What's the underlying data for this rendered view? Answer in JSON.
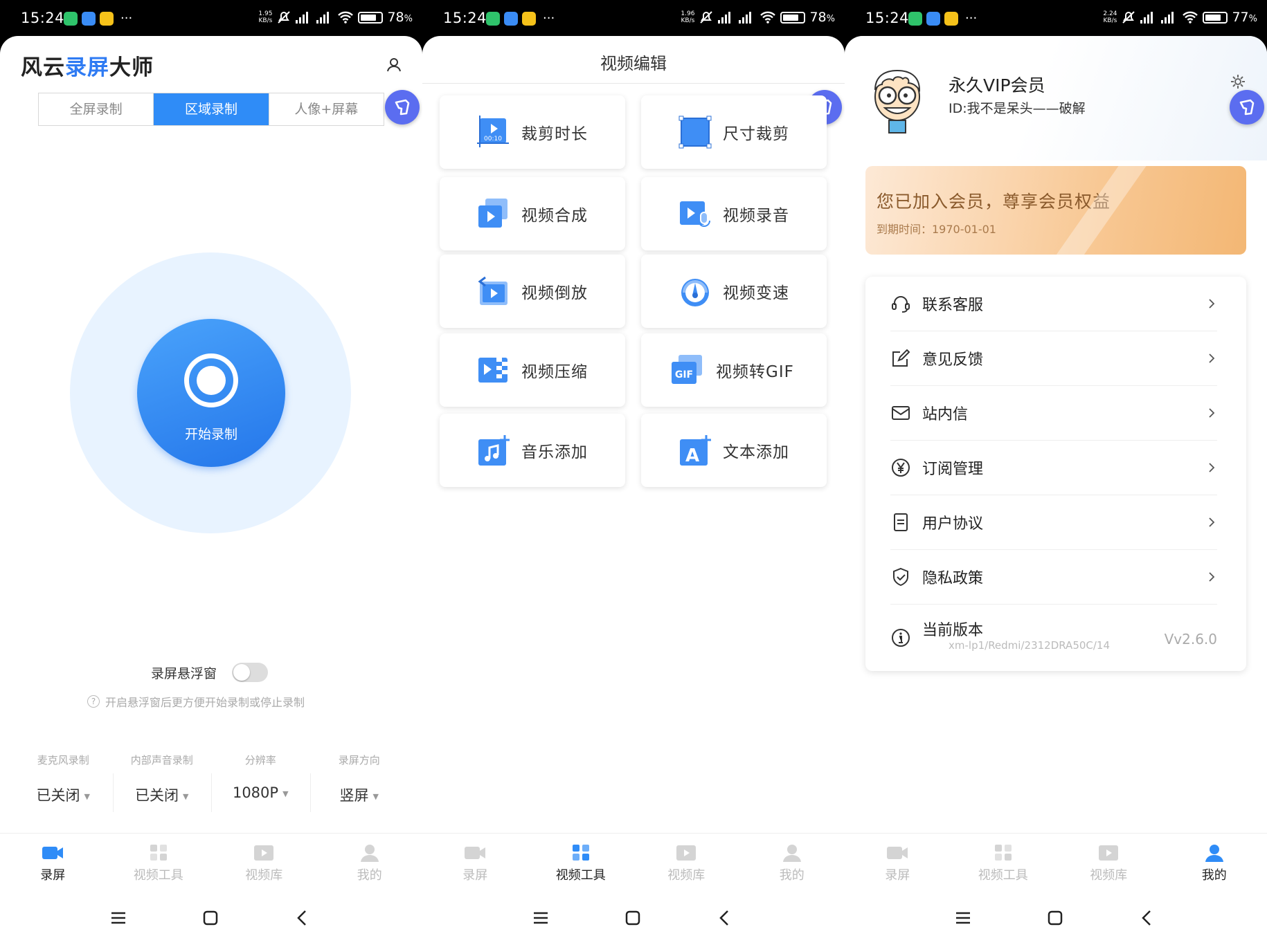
{
  "status": [
    {
      "time": "15:24",
      "speed_top": "1.95",
      "speed_unit": "KB/s",
      "battery": "78",
      "battery_unit": "%",
      "battery_fill": 0.78
    },
    {
      "time": "15:24",
      "speed_top": "1.96",
      "speed_unit": "KB/s",
      "battery": "78",
      "battery_unit": "%",
      "battery_fill": 0.78
    },
    {
      "time": "15:24",
      "speed_top": "2.24",
      "speed_unit": "KB/s",
      "battery": "77",
      "battery_unit": "%",
      "battery_fill": 0.77
    }
  ],
  "colors": {
    "accent": "#2f8cf7",
    "float_button": "#5b6df0",
    "vip_text": "#8a5a2c"
  },
  "record": {
    "brand_prefix": "风云",
    "brand_highlight": "录屏",
    "brand_suffix": "大师",
    "modes": [
      "全屏录制",
      "区域录制",
      "人像+屏幕"
    ],
    "active_mode": 1,
    "start_label": "开始录制",
    "float_label": "录屏悬浮窗",
    "float_enabled": false,
    "float_hint": "开启悬浮窗后更方便开始录制或停止录制",
    "settings": [
      {
        "label": "麦克风录制",
        "value": "已关闭"
      },
      {
        "label": "内部声音录制",
        "value": "已关闭"
      },
      {
        "label": "分辨率",
        "value": "1080P"
      },
      {
        "label": "录屏方向",
        "value": "竖屏"
      }
    ]
  },
  "tools": {
    "title": "视频编辑",
    "items": [
      {
        "label": "裁剪时长",
        "icon": "trim-duration-icon",
        "badge": "00:10"
      },
      {
        "label": "尺寸裁剪",
        "icon": "crop-size-icon"
      },
      {
        "label": "视频合成",
        "icon": "video-merge-icon"
      },
      {
        "label": "视频录音",
        "icon": "video-voice-icon"
      },
      {
        "label": "视频倒放",
        "icon": "video-reverse-icon"
      },
      {
        "label": "视频变速",
        "icon": "video-speed-icon"
      },
      {
        "label": "视频压缩",
        "icon": "video-compress-icon"
      },
      {
        "label": "视频转GIF",
        "icon": "video-gif-icon",
        "badge": "GIF"
      },
      {
        "label": "音乐添加",
        "icon": "music-add-icon"
      },
      {
        "label": "文本添加",
        "icon": "text-add-icon",
        "badge": "A"
      }
    ]
  },
  "profile": {
    "name": "永久VIP会员",
    "id": "ID:我不是呆头——破解",
    "vip_title": "您已加入会员，尊享会员权益",
    "vip_expire": "到期时间：1970-01-01",
    "menu": [
      {
        "label": "联系客服",
        "icon": "headset-icon"
      },
      {
        "label": "意见反馈",
        "icon": "feedback-edit-icon"
      },
      {
        "label": "站内信",
        "icon": "mail-icon"
      },
      {
        "label": "订阅管理",
        "icon": "yuan-coin-icon"
      },
      {
        "label": "用户协议",
        "icon": "document-icon"
      },
      {
        "label": "隐私政策",
        "icon": "shield-check-icon"
      }
    ],
    "version_label": "当前版本",
    "version_sub": "xm-lp1/Redmi/2312DRA50C/14",
    "version_value": "Vv2.6.0"
  },
  "tabbar": {
    "tabs": [
      {
        "label": "录屏",
        "icon": "record-tab-icon"
      },
      {
        "label": "视频工具",
        "icon": "tools-tab-icon"
      },
      {
        "label": "视频库",
        "icon": "library-tab-icon"
      },
      {
        "label": "我的",
        "icon": "profile-tab-icon"
      }
    ],
    "active_per_screen": [
      0,
      1,
      3
    ]
  }
}
